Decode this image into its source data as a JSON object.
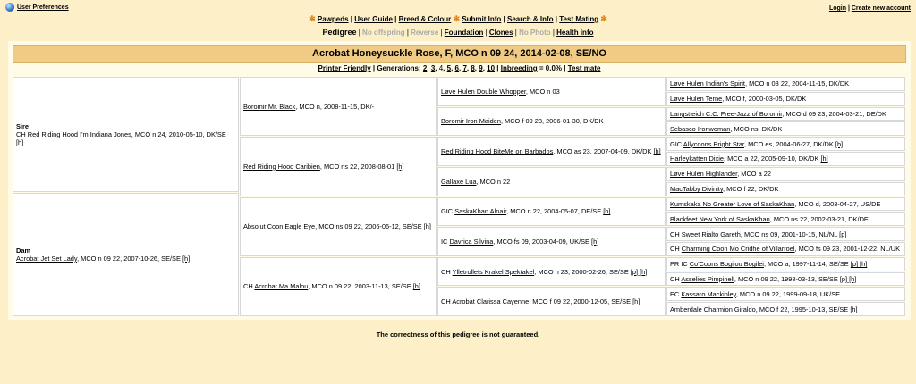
{
  "topbar": {
    "preferences": "User Preferences",
    "login": "Login",
    "create_account": "Create new account"
  },
  "nav_main": [
    "Pawpeds",
    "User Guide",
    "Breed & Colour",
    "Submit Info",
    "Search & Info",
    "Test Mating"
  ],
  "nav_sub": {
    "pedigree": "Pedigree",
    "offspring": "No offspring",
    "reverse": "Reverse",
    "foundation": "Foundation",
    "clones": "Clones",
    "photo": "No Photo",
    "health": "Health info"
  },
  "title": "Acrobat Honeysuckle Rose, F, MCO n 09 24, 2014-02-08, SE/NO",
  "options": {
    "printer": "Printer Friendly",
    "generations_label": "Generations:",
    "generations": [
      "2",
      "3",
      "4",
      "5",
      "6",
      "7",
      "8",
      "9",
      "10"
    ],
    "current_generation": "4",
    "inbreeding_label": "Inbreeding",
    "inbreeding_value": "= 0.0%",
    "testmate": "Test mate"
  },
  "gen1": {
    "sire": {
      "role": "Sire",
      "title": "CH",
      "name": "Red Riding Hood I'm Indiana Jones",
      "info": ", MCO n 24, 2010-05-10, DK/SE",
      "h": "[h]"
    },
    "dam": {
      "role": "Dam",
      "title": "",
      "name": "Acrobat Jet Set Lady",
      "info": ", MCO n 09 22, 2007-10-26, SE/SE",
      "h": "[h]"
    }
  },
  "gen2": [
    {
      "title": "",
      "name": "Boromir Mr. Black",
      "info": ", MCO n, 2008-11-15, DK/-",
      "h": ""
    },
    {
      "title": "",
      "name": "Red Riding Hood Caribien",
      "info": ", MCO ns 22, 2008-08-01",
      "h": "[h]"
    },
    {
      "title": "",
      "name": "Absolut Coon Eagle Eye",
      "info": ", MCO ns 09 22, 2006-06-12, SE/SE",
      "h": "[h]"
    },
    {
      "title": "CH",
      "name": "Acrobat Ma Malou",
      "info": ", MCO n 09 22, 2003-11-13, SE/SE",
      "h": "[h]"
    }
  ],
  "gen3": [
    {
      "title": "",
      "name": "Løve Hulen Double Whopper",
      "info": ", MCO n 03",
      "h": ""
    },
    {
      "title": "",
      "name": "Boromir Iron Maiden",
      "info": ", MCO f 09 23, 2006-01-30, DK/DK",
      "h": ""
    },
    {
      "title": "",
      "name": "Red Riding Hood BiteMe on Barbados",
      "info": ", MCO as 23, 2007-04-09, DK/DK",
      "h": "[h]"
    },
    {
      "title": "",
      "name": "Gallaxe Lua",
      "info": ", MCO n 22",
      "h": ""
    },
    {
      "title": "GIC",
      "name": "SaskaKhan Alnair",
      "info": ", MCO n 22, 2004-05-07, DE/SE",
      "h": "[h]"
    },
    {
      "title": "IC",
      "name": "Davrica Silvina",
      "info": ", MCO fs 09, 2003-04-09, UK/SE",
      "h": "[h]"
    },
    {
      "title": "CH",
      "name": "Ylletrollets Krakel Spektakel",
      "info": ", MCO n 23, 2000-02-26, SE/SE",
      "h": "[p] [h]"
    },
    {
      "title": "CH",
      "name": "Acrobat Clarissa Cayenne",
      "info": ", MCO f 09 22, 2000-12-05, SE/SE",
      "h": "[h]"
    }
  ],
  "gen4": [
    {
      "title": "",
      "name": "Løve Hulen Indian's Spirit",
      "info": ", MCO n 03 22, 2004-11-15, DK/DK",
      "h": ""
    },
    {
      "title": "",
      "name": "Løve Hulen Terne",
      "info": ", MCO f, 2000-03-05, DK/DK",
      "h": ""
    },
    {
      "title": "",
      "name": "Langstteich C.C. Free-Jazz of Boromir",
      "info": ", MCO d 09 23, 2004-03-21, DE/DK",
      "h": ""
    },
    {
      "title": "",
      "name": "Sebasco Ironwoman",
      "info": ", MCO ns, DK/DK",
      "h": ""
    },
    {
      "title": "GIC",
      "name": "Allycoons Bright Star",
      "info": ", MCO es, 2004-06-27, DK/DK",
      "h": "[h]"
    },
    {
      "title": "",
      "name": "Harleykatten Dixie",
      "info": ", MCO a 22, 2005-09-10, DK/DK",
      "h": "[h]"
    },
    {
      "title": "",
      "name": "Løve Hulen Highlander",
      "info": ", MCO a 22",
      "h": ""
    },
    {
      "title": "",
      "name": "MacTabby Divinity",
      "info": ", MCO f 22, DK/DK",
      "h": ""
    },
    {
      "title": "",
      "name": "Kumskaka No Greater Love of SaskaKhan",
      "info": ", MCO d, 2003-04-27, US/DE",
      "h": ""
    },
    {
      "title": "",
      "name": "Blackfeet New York of SaskaKhan",
      "info": ", MCO ns 22, 2002-03-21, DK/DE",
      "h": ""
    },
    {
      "title": "CH",
      "name": "Sweet Rialto Gareth",
      "info": ", MCO ns 09, 2001-10-15, NL/NL",
      "h": "[p]"
    },
    {
      "title": "CH",
      "name": "Charming Coon Mo Cridhe of Villarroel",
      "info": ", MCO fs 09 23, 2001-12-22, NL/UK",
      "h": ""
    },
    {
      "title": "PR IC",
      "name": "Co'Coons Bogilou Bogilei",
      "info": ", MCO a, 1997-11-14, SE/SE",
      "h": "[p] [h]"
    },
    {
      "title": "CH",
      "name": "Asselies Pimpinell",
      "info": ", MCO n 09 22, 1998-03-13, SE/SE",
      "h": "[p] [h]"
    },
    {
      "title": "EC",
      "name": "Kassaro Mackinley",
      "info": ", MCO n 09 22, 1999-09-18, UK/SE",
      "h": ""
    },
    {
      "title": "",
      "name": "Amberdale Charmion Giraldo",
      "info": ", MCO f 22, 1995-10-13, SE/SE",
      "h": "[h]"
    }
  ],
  "footer": "The correctness of this pedigree is not guaranteed."
}
